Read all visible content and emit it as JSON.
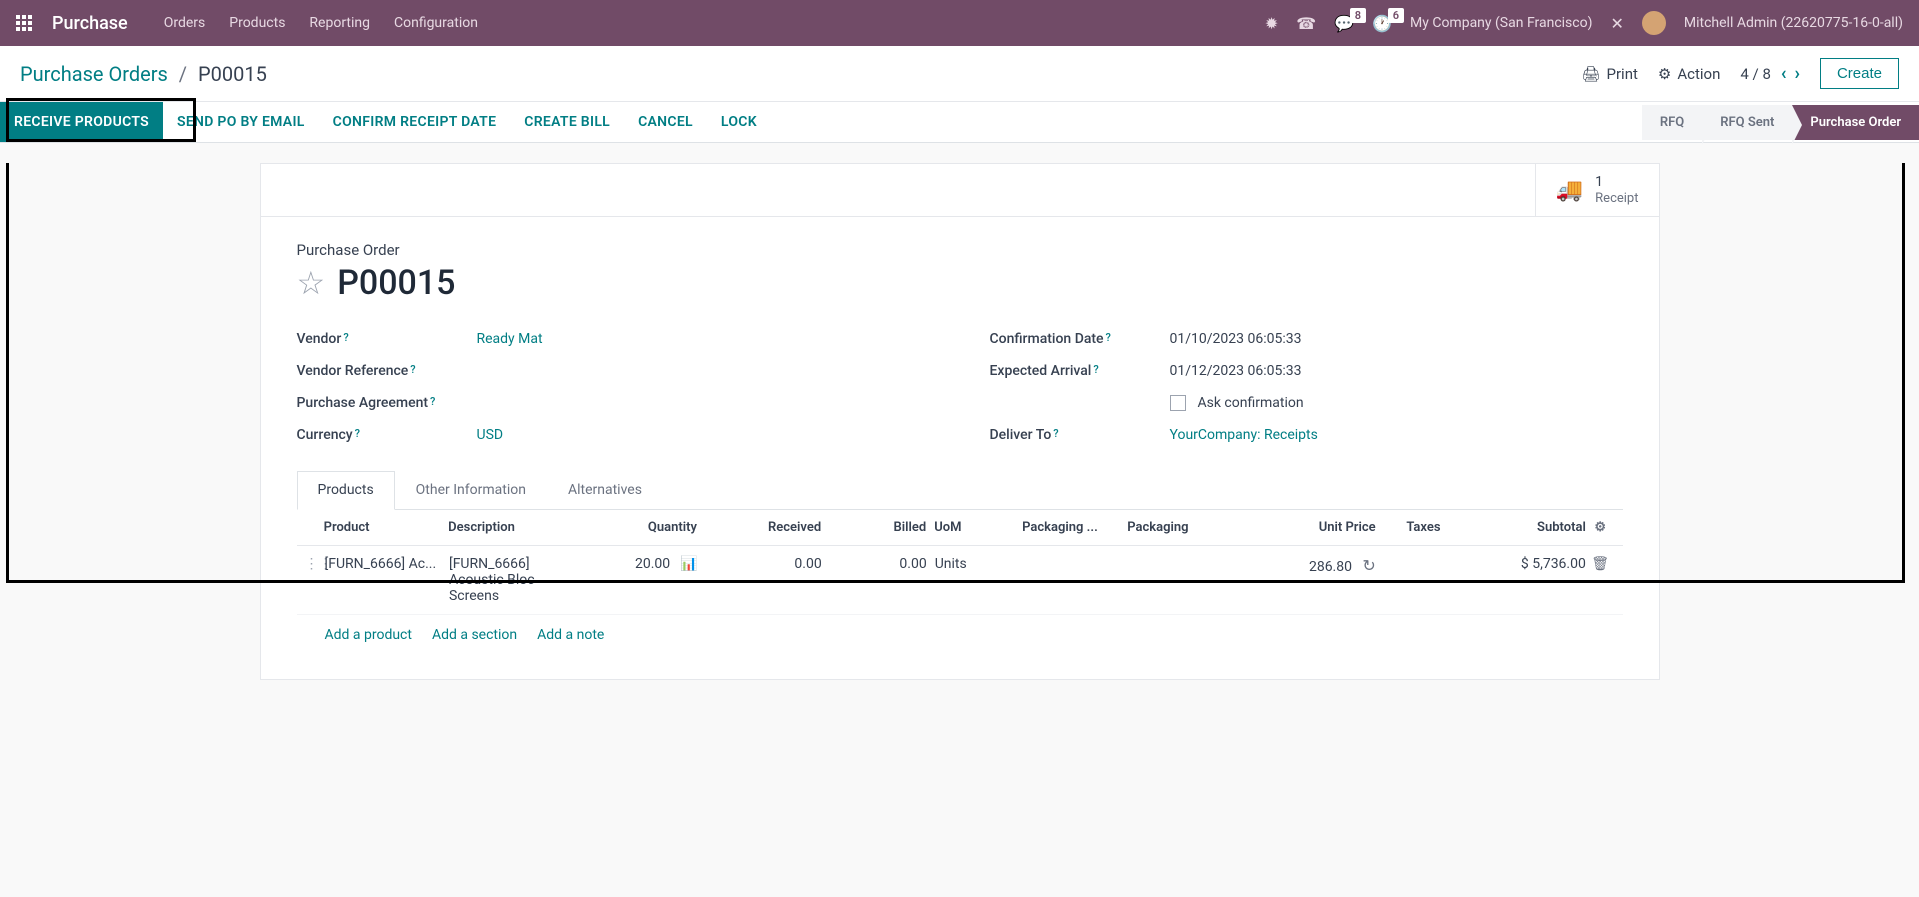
{
  "navbar": {
    "brand": "Purchase",
    "menu": [
      "Orders",
      "Products",
      "Reporting",
      "Configuration"
    ],
    "chat_badge": "8",
    "activity_badge": "6",
    "company": "My Company (San Francisco)",
    "user": "Mitchell Admin (22620775-16-0-all)"
  },
  "breadcrumb": {
    "parent": "Purchase Orders",
    "current": "P00015"
  },
  "controls": {
    "print": "Print",
    "action": "Action",
    "pager": "4 / 8",
    "create": "Create"
  },
  "actions": {
    "receive": "Receive Products",
    "send": "Send PO by Email",
    "confirm": "Confirm Receipt Date",
    "bill": "Create Bill",
    "cancel": "Cancel",
    "lock": "Lock"
  },
  "status": {
    "rfq": "RFQ",
    "rfq_sent": "RFQ Sent",
    "po": "Purchase Order"
  },
  "receipt": {
    "count": "1",
    "label": "Receipt"
  },
  "form": {
    "title_label": "Purchase Order",
    "title": "P00015",
    "vendor_label": "Vendor",
    "vendor": "Ready Mat",
    "vendor_ref_label": "Vendor Reference",
    "agreement_label": "Purchase Agreement",
    "currency_label": "Currency",
    "currency": "USD",
    "confirm_date_label": "Confirmation Date",
    "confirm_date": "01/10/2023 06:05:33",
    "arrival_label": "Expected Arrival",
    "arrival": "01/12/2023 06:05:33",
    "ask_confirm": "Ask confirmation",
    "deliver_label": "Deliver To",
    "deliver": "YourCompany: Receipts"
  },
  "tabs": {
    "products": "Products",
    "other": "Other Information",
    "alt": "Alternatives"
  },
  "table": {
    "headers": {
      "product": "Product",
      "desc": "Description",
      "qty": "Quantity",
      "recv": "Received",
      "billed": "Billed",
      "uom": "UoM",
      "pkgqty": "Packaging ...",
      "pkg": "Packaging",
      "price": "Unit Price",
      "tax": "Taxes",
      "sub": "Subtotal"
    },
    "row": {
      "product": "[FURN_6666] Ac...",
      "desc": "[FURN_6666] Acoustic Bloc Screens",
      "qty": "20.00",
      "recv": "0.00",
      "billed": "0.00",
      "uom": "Units",
      "price": "286.80",
      "sub": "$ 5,736.00"
    },
    "add_product": "Add a product",
    "add_section": "Add a section",
    "add_note": "Add a note"
  }
}
